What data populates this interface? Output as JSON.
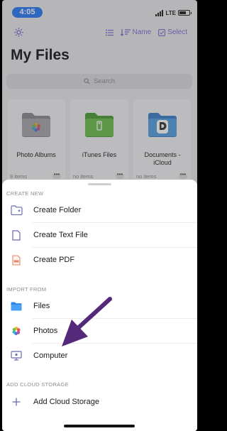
{
  "status_bar": {
    "time": "4:05",
    "network": "LTE"
  },
  "nav": {
    "sort_label": "Name",
    "select_label": "Select"
  },
  "page": {
    "title": "My Files",
    "search_placeholder": "Search"
  },
  "folders": [
    {
      "name": "Photo Albums",
      "count": "9 items"
    },
    {
      "name": "iTunes Files",
      "count": "no items"
    },
    {
      "name": "Documents - iCloud",
      "count": "no items"
    }
  ],
  "sheet": {
    "create_new": {
      "header": "CREATE NEW",
      "items": [
        {
          "label": "Create Folder",
          "icon": "folder-plus-icon"
        },
        {
          "label": "Create Text File",
          "icon": "text-file-icon"
        },
        {
          "label": "Create PDF",
          "icon": "pdf-file-icon"
        }
      ]
    },
    "import_from": {
      "header": "IMPORT FROM",
      "items": [
        {
          "label": "Files",
          "icon": "folder-icon"
        },
        {
          "label": "Photos",
          "icon": "photos-icon"
        },
        {
          "label": "Computer",
          "icon": "computer-icon"
        }
      ]
    },
    "cloud": {
      "header": "ADD CLOUD STORAGE",
      "items": [
        {
          "label": "Add Cloud Storage",
          "icon": "plus-icon"
        }
      ]
    }
  },
  "colors": {
    "accent": "#7b72d6",
    "time_pill": "#2d7cf6",
    "arrow": "#55297a"
  }
}
